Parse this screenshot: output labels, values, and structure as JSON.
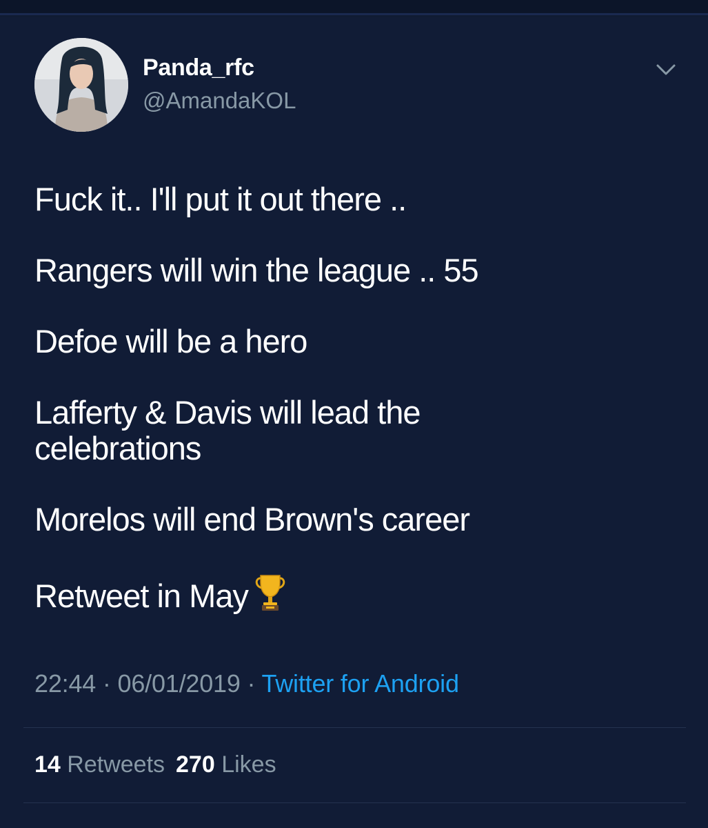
{
  "tweet": {
    "display_name": "Panda_rfc",
    "handle": "@AmandaKOL",
    "lines": [
      "Fuck it..  I'll put it out there ..",
      "Rangers will win the league .. 55",
      "Defoe will be a hero",
      "Lafferty & Davis will lead the",
      "celebrations",
      "Morelos will end Brown's career",
      "Retweet in May"
    ],
    "emoji": "trophy-icon",
    "time": "22:44",
    "separator": " · ",
    "date": "06/01/2019",
    "source": "Twitter for Android",
    "retweets_count": "14",
    "retweets_label": "Retweets",
    "likes_count": "270",
    "likes_label": "Likes"
  },
  "colors": {
    "background": "#111c36",
    "text": "#ffffff",
    "secondary_text": "#8899a6",
    "link": "#1da1f2"
  }
}
